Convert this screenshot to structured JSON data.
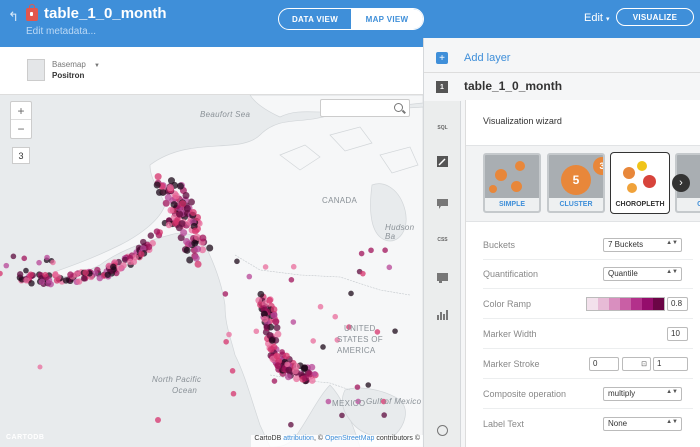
{
  "header": {
    "back_icon": "back-arrow-icon",
    "lock_icon": "lock-icon",
    "title": "table_1_0_month",
    "edit_metadata": "Edit metadata...",
    "views": [
      {
        "label": "DATA VIEW",
        "active": false
      },
      {
        "label": "MAP VIEW",
        "active": true
      }
    ],
    "edit_menu": "Edit",
    "visualize_label": "VISUALIZE",
    "accent_color": "#3f8fd9"
  },
  "basemap": {
    "label": "Basemap",
    "value": "Positron"
  },
  "map": {
    "zoom_in": "+",
    "zoom_out": "−",
    "zoom_level": "3",
    "labels": {
      "beaufort_sea": "Beaufort Sea",
      "canada": "CANADA",
      "hudson_bay": "Hudson Ba",
      "united_states": "UNITED",
      "states_of": "STATES OF",
      "america": "AMERICA",
      "north_pacific": "North Pacific",
      "ocean": "Ocean",
      "mexico": "MEXICO",
      "gulf_of_mexico": "Gulf of Mexico"
    },
    "attribution_prefix": "CartoDB ",
    "attribution_link": "attribution",
    "attribution_mid": ", © ",
    "attribution_osm": "OpenStreetMap",
    "attribution_suffix": " contributors ©",
    "logo": "CARTODB",
    "point_colors": [
      "#1c0a1a",
      "#5e0b3e",
      "#a0135b",
      "#d6336c",
      "#e86c9c",
      "#b74597"
    ]
  },
  "panel": {
    "add_layer": "Add layer",
    "layer_number": "1",
    "layer_name": "table_1_0_month",
    "sidebar": [
      "SQL",
      "wizard-icon",
      "infowindow-icon",
      "CSS",
      "legend-icon",
      "filter-icon"
    ],
    "wizard_title": "Visualization wizard",
    "viz_types": [
      {
        "label": "SIMPLE",
        "active": false
      },
      {
        "label": "CLUSTER",
        "active": false,
        "badge_1": "5",
        "badge_2": "3"
      },
      {
        "label": "CHOROPLETH",
        "active": true
      },
      {
        "label": "CAT",
        "active": false
      }
    ],
    "properties": {
      "buckets_label": "Buckets",
      "buckets_value": "7 Buckets",
      "quantification_label": "Quantification",
      "quantification_value": "Quantile",
      "color_ramp_label": "Color Ramp",
      "color_ramp_opacity": "0.8",
      "color_ramp_colors": [
        "#f3e1ec",
        "#e7bbd6",
        "#d98fbf",
        "#c95fa5",
        "#b3318b",
        "#950d6c",
        "#6b0546"
      ],
      "marker_width_label": "Marker Width",
      "marker_width_value": "10",
      "marker_stroke_label": "Marker Stroke",
      "marker_stroke_width": "0",
      "marker_stroke_opacity": "1",
      "composite_label": "Composite operation",
      "composite_value": "multiply",
      "label_text_label": "Label Text",
      "label_text_value": "None"
    }
  }
}
